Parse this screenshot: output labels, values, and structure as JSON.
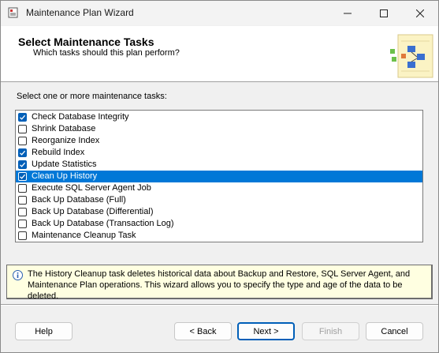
{
  "window": {
    "title": "Maintenance Plan Wizard",
    "minimize_icon": "minimize-icon",
    "maximize_icon": "maximize-icon",
    "close_icon": "close-icon"
  },
  "header": {
    "title": "Select Maintenance Tasks",
    "subtitle": "Which tasks should this plan perform?"
  },
  "instruction": "Select one or more maintenance tasks:",
  "tasks": [
    {
      "label": "Check Database Integrity",
      "checked": true,
      "selected": false
    },
    {
      "label": "Shrink Database",
      "checked": false,
      "selected": false
    },
    {
      "label": "Reorganize Index",
      "checked": false,
      "selected": false
    },
    {
      "label": "Rebuild Index",
      "checked": true,
      "selected": false
    },
    {
      "label": "Update Statistics",
      "checked": true,
      "selected": false
    },
    {
      "label": "Clean Up History",
      "checked": true,
      "selected": true
    },
    {
      "label": "Execute SQL Server Agent Job",
      "checked": false,
      "selected": false
    },
    {
      "label": "Back Up Database (Full)",
      "checked": false,
      "selected": false
    },
    {
      "label": "Back Up Database (Differential)",
      "checked": false,
      "selected": false
    },
    {
      "label": "Back Up Database (Transaction Log)",
      "checked": false,
      "selected": false
    },
    {
      "label": "Maintenance Cleanup Task",
      "checked": false,
      "selected": false
    }
  ],
  "info": {
    "line1": "The History Cleanup task deletes historical data about Backup and Restore, SQL Server Agent, and",
    "line2": "Maintenance Plan operations.  This wizard allows you to specify the type and age of the data to be deleted."
  },
  "buttons": {
    "help": "Help",
    "back": "< Back",
    "next": "Next >",
    "finish": "Finish",
    "cancel": "Cancel"
  },
  "colors": {
    "selection": "#0078d7",
    "checkbox_checked": "#005fb8",
    "info_background": "#ffffe1"
  }
}
